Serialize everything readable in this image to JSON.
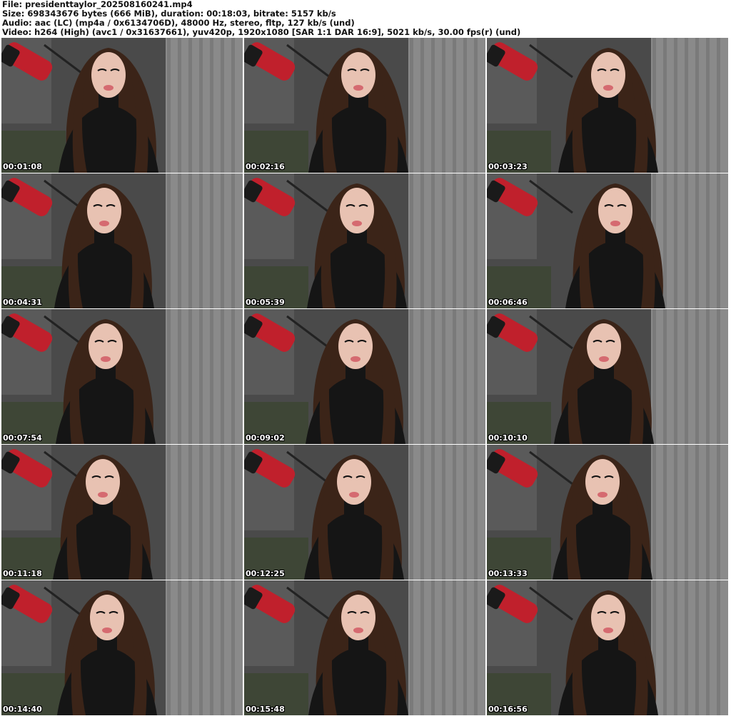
{
  "header": {
    "file_line": "File: presidenttaylor_202508160241.mp4",
    "size_line": "Size: 698343676 bytes (666 MiB), duration: 00:18:03, bitrate: 5157 kb/s",
    "audio_line": "Audio: aac (LC) (mp4a / 0x6134706D), 48000 Hz, stereo, fltp, 127 kb/s (und)",
    "video_line": "Video: h264 (High) (avc1 / 0x31637661), yuv420p, 1920x1080 [SAR 1:1 DAR 16:9], 5021 kb/s, 30.00 fps(r) (und)"
  },
  "thumbnails": [
    {
      "timestamp": "00:01:08"
    },
    {
      "timestamp": "00:02:16"
    },
    {
      "timestamp": "00:03:23"
    },
    {
      "timestamp": "00:04:31"
    },
    {
      "timestamp": "00:05:39"
    },
    {
      "timestamp": "00:06:46"
    },
    {
      "timestamp": "00:07:54"
    },
    {
      "timestamp": "00:09:02"
    },
    {
      "timestamp": "00:10:10"
    },
    {
      "timestamp": "00:11:18"
    },
    {
      "timestamp": "00:12:25"
    },
    {
      "timestamp": "00:13:33"
    },
    {
      "timestamp": "00:14:40"
    },
    {
      "timestamp": "00:15:48"
    },
    {
      "timestamp": "00:16:56"
    }
  ],
  "colors": {
    "background": "#ffffff",
    "curtain": "#8a8a8a",
    "wall": "#4a4a4a",
    "hair": "#3b2418",
    "skin": "#e8c2b2",
    "microphone": "#c0202c",
    "clothing": "#151515"
  }
}
